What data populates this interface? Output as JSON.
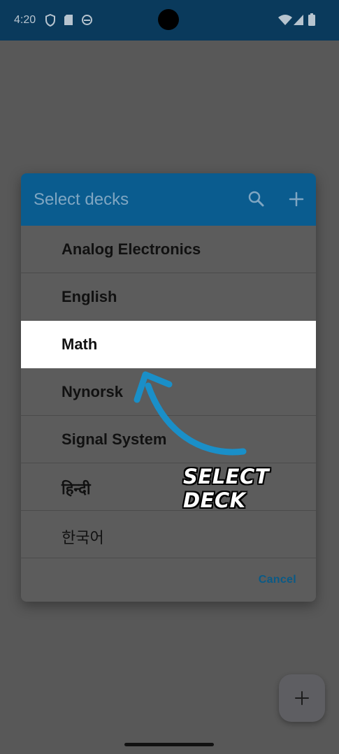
{
  "status_bar": {
    "time": "4:20",
    "icons": [
      "shield-icon",
      "sd-card-icon",
      "sync-icon",
      "wifi-icon",
      "cell-signal-icon",
      "battery-icon"
    ]
  },
  "dialog": {
    "title": "Select decks",
    "search_icon": "search-icon",
    "add_icon": "plus-icon",
    "decks": [
      {
        "label": "Analog Electronics",
        "selected": false
      },
      {
        "label": "English",
        "selected": false
      },
      {
        "label": "Math",
        "selected": true
      },
      {
        "label": "Nynorsk",
        "selected": false
      },
      {
        "label": "Signal System",
        "selected": false
      },
      {
        "label": "हिन्दी",
        "selected": false
      },
      {
        "label": "한국어",
        "selected": false
      }
    ],
    "cancel_label": "Cancel"
  },
  "annotation": {
    "text": "SELECT DECK",
    "arrow_color": "#1a8fc8"
  },
  "fab": {
    "icon": "plus-icon"
  },
  "colors": {
    "header_bg": "#0a5c8f",
    "status_bar_bg": "#0a3a5c",
    "accent": "#0a5a86",
    "selected_row_bg": "#ffffff"
  }
}
